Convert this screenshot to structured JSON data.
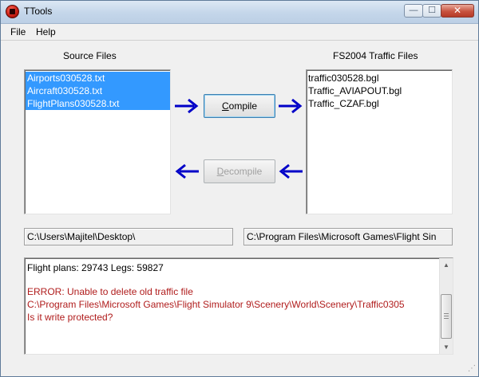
{
  "window": {
    "title": "TTools",
    "minimize_glyph": "—",
    "maximize_glyph": "☐",
    "close_glyph": "✕"
  },
  "menu": {
    "file": "File",
    "help": "Help"
  },
  "source": {
    "label": "Source Files",
    "items": [
      "Airports030528.txt",
      "Aircraft030528.txt",
      "FlightPlans030528.txt"
    ],
    "path": "C:\\Users\\Majitel\\Desktop\\"
  },
  "traffic": {
    "label": "FS2004 Traffic Files",
    "items": [
      "traffic030528.bgl",
      "Traffic_AVIAPOUT.bgl",
      "Traffic_CZAF.bgl"
    ],
    "path": "C:\\Program Files\\Microsoft Games\\Flight Sin"
  },
  "buttons": {
    "compile_accel": "C",
    "compile_rest": "ompile",
    "decompile_accel": "D",
    "decompile_rest": "ecompile"
  },
  "log": {
    "stats": "Flight plans: 29743   Legs: 59827",
    "error_line1": "ERROR: Unable to delete old traffic file",
    "error_line2": "C:\\Program Files\\Microsoft Games\\Flight Simulator 9\\Scenery\\World\\Scenery\\Traffic0305",
    "error_line3": "Is it write protected?"
  },
  "colors": {
    "arrow": "#0000c8",
    "selection": "#3399ff",
    "error_text": "#b01c1c"
  }
}
